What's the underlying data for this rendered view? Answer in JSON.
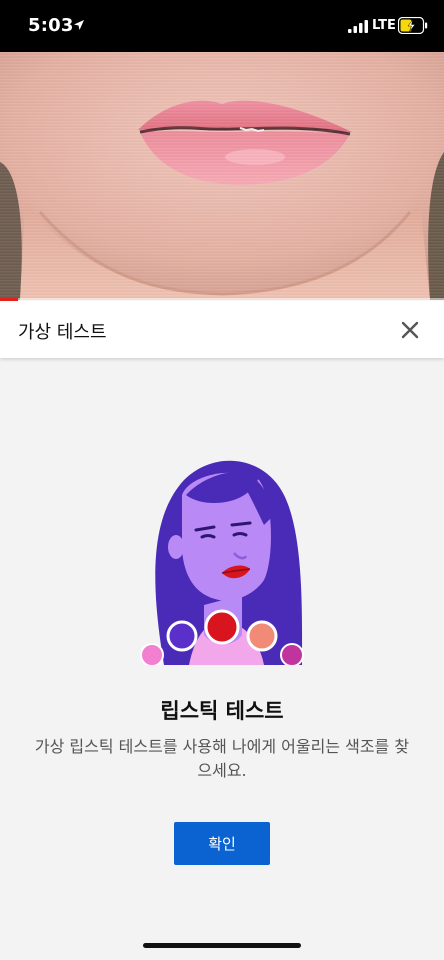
{
  "status_bar": {
    "time": "5:03",
    "network": "LTE",
    "icons": [
      "location-arrow-icon",
      "signal-bars-icon",
      "battery-charging-icon"
    ]
  },
  "video": {
    "progress": 0.04
  },
  "sheet": {
    "title": "가상 테스트",
    "close_icon": "close-icon"
  },
  "content": {
    "illustration": "woman-face-illustration",
    "swatch_colors": [
      "#f27fcf",
      "#5b2fc9",
      "#d8151f",
      "#f28a78",
      "#c2349d"
    ],
    "heading": "립스틱 테스트",
    "description": "가상 립스틱 테스트를 사용해 나에게 어울리는 색조를 찾으세요.",
    "confirm_label": "확인"
  },
  "colors": {
    "accent": "#0b63d2",
    "progress": "#e62117"
  }
}
